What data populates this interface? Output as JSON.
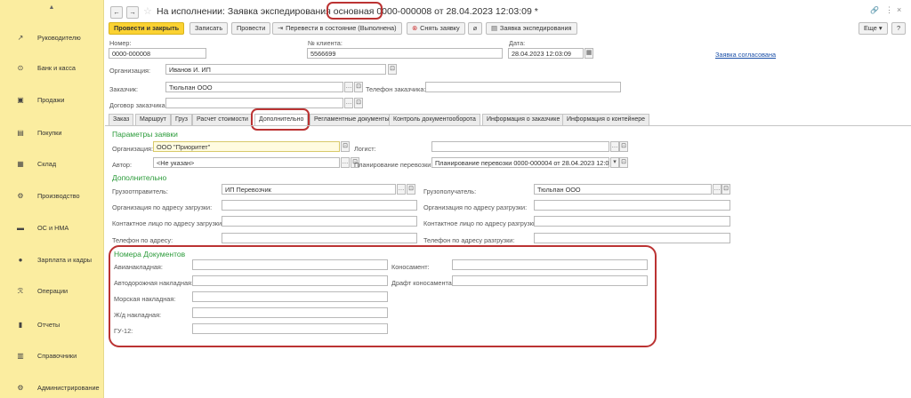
{
  "sidebar": {
    "collapse_icon": "caret-up",
    "items": [
      {
        "icon": "trend-icon",
        "glyph": "↗",
        "label": "Руководителю"
      },
      {
        "icon": "bank-icon",
        "glyph": "⊙",
        "label": "Банк и касса"
      },
      {
        "icon": "cart-icon",
        "glyph": "▣",
        "label": "Продажи"
      },
      {
        "icon": "purchase-icon",
        "glyph": "▤",
        "label": "Покупки"
      },
      {
        "icon": "warehouse-icon",
        "glyph": "▦",
        "label": "Склад"
      },
      {
        "icon": "production-icon",
        "glyph": "⚙",
        "label": "Производство"
      },
      {
        "icon": "assets-icon",
        "glyph": "▬",
        "label": "ОС и НМА"
      },
      {
        "icon": "people-icon",
        "glyph": "●",
        "label": "Зарплата и кадры"
      },
      {
        "icon": "operations-icon",
        "glyph": "ℛ",
        "label": "Операции"
      },
      {
        "icon": "reports-icon",
        "glyph": "▮",
        "label": "Отчеты"
      },
      {
        "icon": "reference-icon",
        "glyph": "▥",
        "label": "Справочники"
      },
      {
        "icon": "admin-icon",
        "glyph": "⚙",
        "label": "Администрирование"
      }
    ]
  },
  "titlebar": {
    "title_prefix": "На исполнении: Заявка экспедирования ",
    "title_highlight": "основная",
    "title_suffix": " 0000-000008 от 28.04.2023 12:03:09 *"
  },
  "toolbar": {
    "post_close": "Провести и закрыть",
    "save": "Записать",
    "post": "Провести",
    "to_state": "Перевести в состояние (Выполнена)",
    "remove": "Снять заявку",
    "request": "Заявка экспедирования",
    "more": "Еще",
    "help": "?"
  },
  "header": {
    "number_label": "Номер:",
    "number_value": "0000-000008",
    "client_no_label": "№ клиента:",
    "client_no_value": "5566699",
    "date_label": "Дата:",
    "date_value": "28.04.2023 12:03:09",
    "approved_link": "Заявка согласована",
    "org_label": "Организация:",
    "org_value": "Иванов И. ИП",
    "customer_label": "Заказчик:",
    "customer_value": "Тюльпан ООО",
    "phone_label": "Телефон заказчика:",
    "phone_value": "",
    "contract_label": "Договор заказчика:",
    "contract_value": ""
  },
  "tabs": [
    "Заказ",
    "Маршрут",
    "Груз",
    "Расчет стоимости",
    "Дополнительно",
    "Регламентные документы",
    "Контроль документооборота",
    "Информация о заказчике",
    "Информация о контейнере"
  ],
  "params": {
    "title": "Параметры заявки",
    "org_label": "Организация:",
    "org_value": "ООО \"Приоритет\"",
    "logist_label": "Логист:",
    "logist_value": "",
    "author_label": "Автор:",
    "author_value": "<Не указан>",
    "planning_label": "Планирование перевозки:",
    "planning_value": "Планирование перевозки 0000-000004 от 28.04.2023 12:03:0"
  },
  "extra": {
    "title": "Дополнительно",
    "shipper_label": "Грузоотправитель:",
    "shipper_value": "ИП Перевозчик",
    "consignee_label": "Грузополучатель:",
    "consignee_value": "Тюльпан ООО",
    "load_org_label": "Организация по адресу загрузки:",
    "unload_org_label": "Организация по адресу разгрузки:",
    "load_contact_label": "Контактное лицо по адресу загрузки:",
    "unload_contact_label": "Контактное лицо по адресу разгрузки:",
    "load_phone_label": "Телефон по адресу:",
    "unload_phone_label": "Телефон по адресу разгрузки:"
  },
  "docs": {
    "title": "Номера Документов",
    "awb_label": "Авианакладная:",
    "road_label": "Автодорожная накладная:",
    "sea_label": "Морская накладная:",
    "rail_label": "Ж/д накладная:",
    "gu_label": "ГУ-12:",
    "bill_label": "Коносамент:",
    "draft_label": "Драфт коносамента:"
  }
}
